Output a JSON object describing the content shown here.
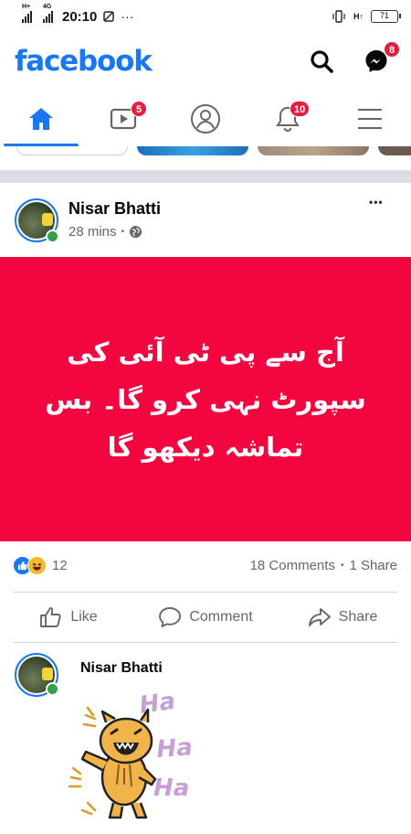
{
  "status_bar": {
    "network_left_1": "H+",
    "network_left_2": "4G",
    "time": "20:10",
    "ellipsis": "···",
    "network_right": "H↑",
    "battery": "71"
  },
  "header": {
    "logo": "facebook",
    "messenger_badge": "8"
  },
  "nav": {
    "tabs": [
      {
        "name": "home",
        "badge": ""
      },
      {
        "name": "watch",
        "badge": "5"
      },
      {
        "name": "profile",
        "badge": ""
      },
      {
        "name": "notifications",
        "badge": "10"
      },
      {
        "name": "menu",
        "badge": ""
      }
    ]
  },
  "post": {
    "author": "Nisar Bhatti",
    "time": "28 mins",
    "dot": "•",
    "more": "•••",
    "text_line_1": "آج سے پی ٹی آئی کی",
    "text_line_2": "سپورٹ نہی کرو گا۔ بس",
    "text_line_3": "تماشہ دیکھو گا",
    "reaction_count": "12",
    "comments": "18 Comments",
    "shares": "1 Share",
    "actions": {
      "like": "Like",
      "comment": "Comment",
      "share": "Share"
    }
  },
  "comment": {
    "author": "Nisar Bhatti",
    "sticker_text": "Ha Ha Ha"
  },
  "colors": {
    "brand": "#1877f2",
    "post_background": "#f3063f",
    "badge": "#e41e3f",
    "online": "#31a24c"
  }
}
